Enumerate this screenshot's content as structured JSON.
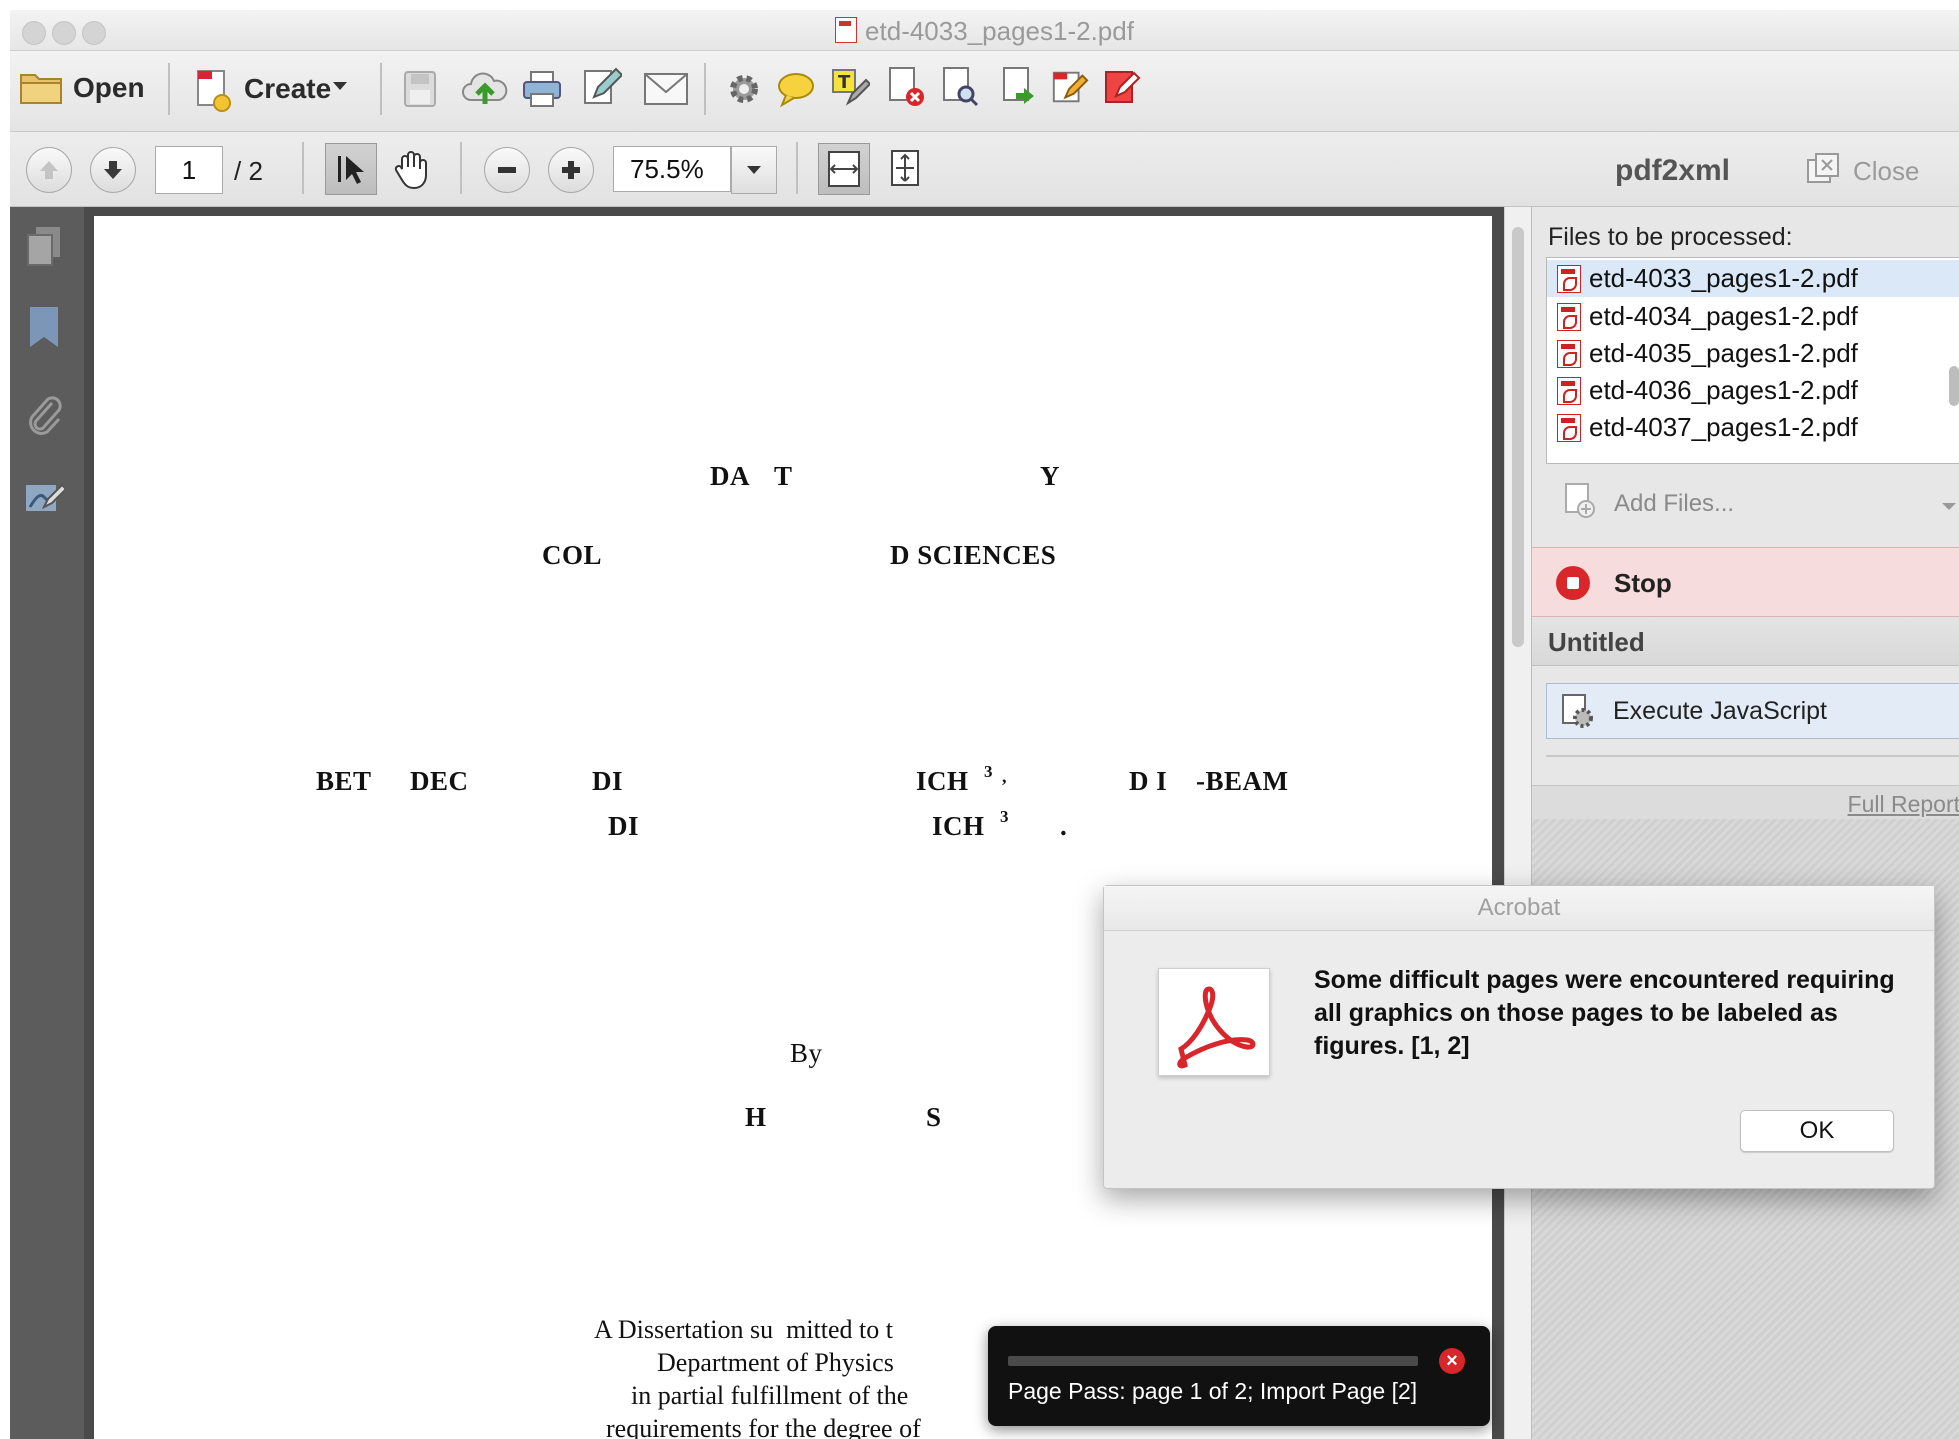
{
  "window": {
    "title": "etd-4033_pages1-2.pdf"
  },
  "toolbar": {
    "open_label": "Open",
    "create_label": "Create"
  },
  "nav": {
    "page_current": "1",
    "page_total": "/ 2",
    "zoom": "75.5%"
  },
  "panel": {
    "title": "pdf2xml",
    "close_label": "Close",
    "files_header": "Files to be processed:",
    "files": [
      "etd-4033_pages1-2.pdf",
      "etd-4034_pages1-2.pdf",
      "etd-4035_pages1-2.pdf",
      "etd-4036_pages1-2.pdf",
      "etd-4037_pages1-2.pdf"
    ],
    "selected_file_index": 0,
    "add_files_label": "Add Files...",
    "stop_label": "Stop",
    "action_list_name": "Untitled",
    "action_step_label": "Execute JavaScript",
    "full_report_label": "Full Report"
  },
  "document": {
    "lines": [
      [
        "DA",
        "T",
        "Y"
      ],
      [
        "COL",
        "D SCIENCES"
      ],
      [
        "BET",
        "DEC",
        "DI",
        "ICH",
        "3",
        ",",
        "D I",
        "-BEAM"
      ],
      [
        "DI",
        "ICH",
        "3",
        "."
      ],
      [
        "By"
      ],
      [
        "H",
        "S"
      ]
    ],
    "body": [
      "A Dissertation su  mitted to t",
      "Department of Physics",
      "in partial fulfillment of the",
      "requirements for the degree of"
    ]
  },
  "dialog": {
    "title": "Acrobat",
    "message": "Some difficult pages were encountered requiring all graphics on those pages to be labeled as figures. [1, 2]",
    "ok_label": "OK"
  },
  "progress": {
    "text": "Page Pass: page 1 of 2; Import Page [2]",
    "fraction": 0.0
  },
  "colors": {
    "stop_bg": "#f7dcdd",
    "stop_icon": "#d8262a",
    "selection": "#dbe8f7",
    "acrobat_red": "#d8262a"
  }
}
